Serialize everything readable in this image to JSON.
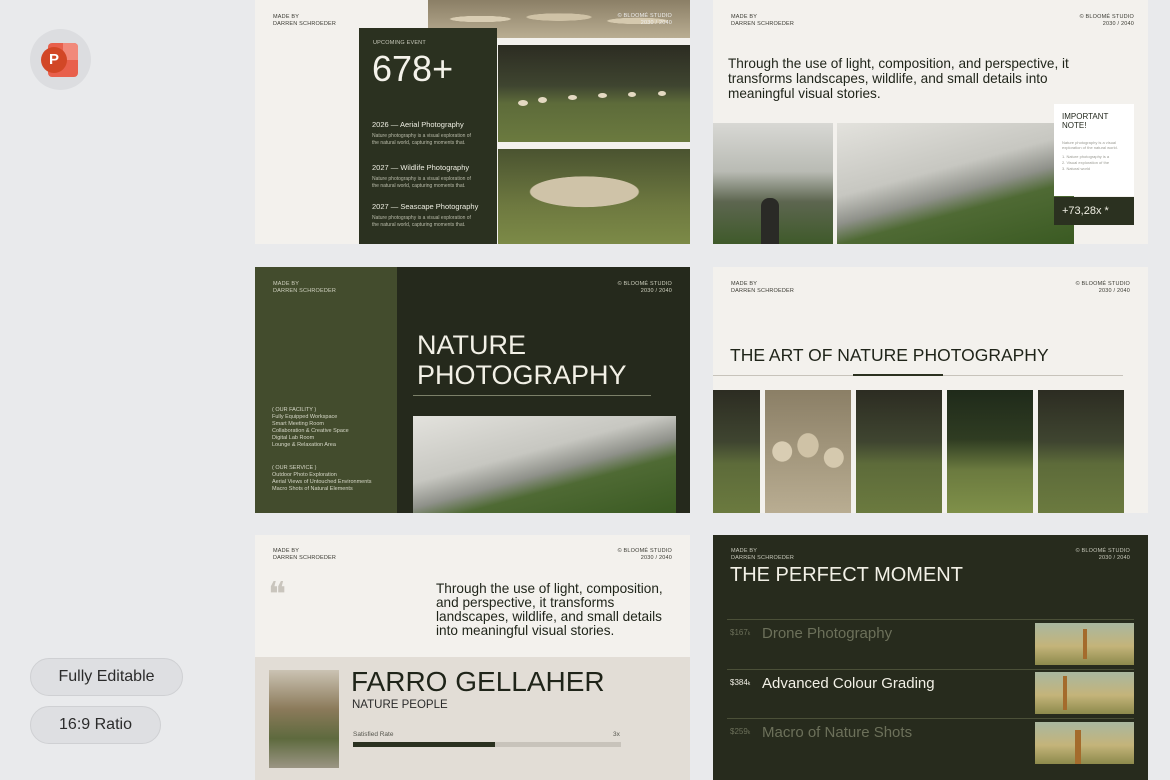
{
  "badges": {
    "fully_editable": "Fully Editable",
    "ratio": "16:9 Ratio"
  },
  "common": {
    "made_by": "MADE BY",
    "author": "DARREN SCHROEDER",
    "studio": "© BLOOMÉ STUDIO",
    "years": "2030 / 2040"
  },
  "slide1": {
    "upcoming": "UPCOMING EVENT",
    "big_number": "678+",
    "events": [
      {
        "title": "2026 — Aerial Photography",
        "desc1": "Nature photography is a visual exploration of",
        "desc2": "the natural world, capturing moments that."
      },
      {
        "title": "2027 — Wildlife Photography",
        "desc1": "Nature photography is a visual exploration of",
        "desc2": "the natural world, capturing moments that."
      },
      {
        "title": "2027 — Seascape Photography",
        "desc1": "Nature photography is a visual exploration of",
        "desc2": "the natural world, capturing moments that."
      }
    ]
  },
  "slide2": {
    "statement_l1": "Through the use of light, composition, and perspective, it",
    "statement_l2": "transforms landscapes, wildlife, and small details into",
    "statement_l3": "meaningful visual stories.",
    "note_title_l1": "IMPORTANT",
    "note_title_l2": "NOTE!",
    "note_desc1": "Nature photography is a visual",
    "note_desc2": "exploration of the natural world.",
    "note_list": [
      "1.  Nature photography is a",
      "2.  Visual exploration of the",
      "3.  Natural world"
    ],
    "stat": "+73,28x *"
  },
  "slide3": {
    "title_l1": "NATURE",
    "title_l2": "PHOTOGRAPHY",
    "facility_head": "( OUR FACILITY )",
    "facility": [
      "Fully Equipped Workspace",
      "Smart Meeting Room",
      "Collaboration & Creative Space",
      "Digital Lab Room",
      "Lounge & Relaxation Area"
    ],
    "service_head": "( OUR SERVICE )",
    "service": [
      "Outdoor Photo Exploration",
      "Aerial Views of Untouched Environments",
      "Macro Shots of Natural Elements"
    ]
  },
  "slide4": {
    "title": "THE ART OF NATURE PHOTOGRAPHY"
  },
  "slide5": {
    "quote_l1": "Through the use of light, composition,",
    "quote_l2": "and perspective, it transforms",
    "quote_l3": "landscapes, wildlife, and small details",
    "quote_l4": "into meaningful visual stories.",
    "name": "FARRO GELLAHER",
    "role": "NATURE PEOPLE",
    "rate_label": "Satisfied Rate",
    "rate_value": "3x",
    "rate_fraction": 0.53
  },
  "slide6": {
    "title": "THE PERFECT MOMENT",
    "rows": [
      {
        "price": "$167",
        "unit": "k",
        "label": "Drone Photography"
      },
      {
        "price": "$384",
        "unit": "k",
        "label": "Advanced Colour Grading"
      },
      {
        "price": "$259",
        "unit": "k",
        "label": "Macro of Nature Shots"
      }
    ]
  }
}
